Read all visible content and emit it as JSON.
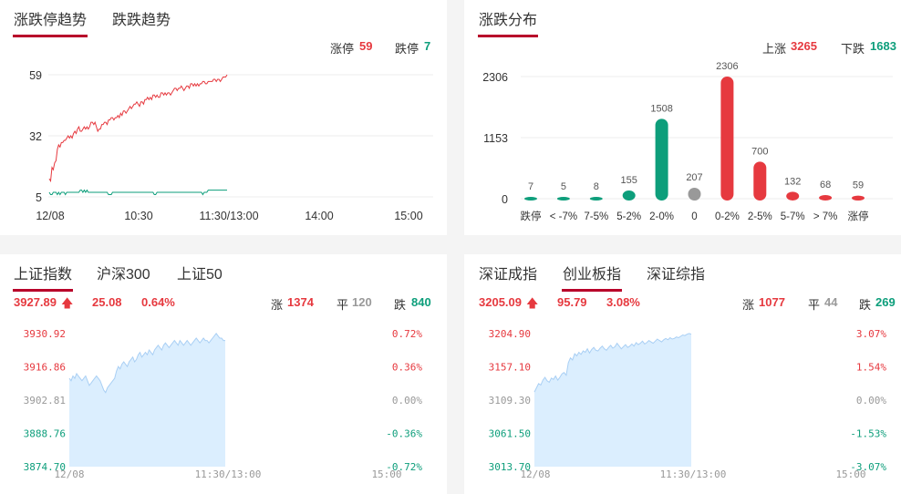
{
  "colors": {
    "up": "#e6393f",
    "down": "#0d9e7b",
    "flat": "#999999",
    "accent": "#b8002a",
    "area": "#dbeefe",
    "area_line": "#a9cff4"
  },
  "limit_panel": {
    "tabs": [
      "涨跌停趋势",
      "跌跌趋势"
    ],
    "up_label": "涨停",
    "up_value": "59",
    "down_label": "跌停",
    "down_value": "7"
  },
  "dist_panel": {
    "title": "涨跌分布",
    "up_label": "上涨",
    "up_value": "3265",
    "down_label": "下跌",
    "down_value": "1683"
  },
  "sh_panel": {
    "tabs": [
      "上证指数",
      "沪深300",
      "上证50"
    ],
    "price": "3927.89",
    "change": "25.08",
    "pct": "0.64%",
    "up_label": "涨",
    "up_value": "1374",
    "flat_label": "平",
    "flat_value": "120",
    "down_label": "跌",
    "down_value": "840"
  },
  "cyb_panel": {
    "tabs": [
      "深证成指",
      "创业板指",
      "深证综指"
    ],
    "price": "3205.09",
    "change": "95.79",
    "pct": "3.08%",
    "up_label": "涨",
    "up_value": "1077",
    "flat_label": "平",
    "flat_value": "44",
    "down_label": "跌",
    "down_value": "269"
  },
  "chart_data": [
    {
      "type": "line",
      "chart": "limit-trend",
      "y_ticks": [
        "59",
        "32",
        "5"
      ],
      "ylim": [
        5,
        59
      ],
      "x_ticks": [
        "12/08",
        "10:30",
        "11:30/13:00",
        "14:00",
        "15:00"
      ],
      "series": [
        {
          "color": "#e6393f",
          "values": [
            13,
            12,
            18,
            17,
            20,
            21,
            26,
            28,
            27,
            29,
            29,
            30,
            30,
            31,
            32,
            31,
            32,
            31,
            33,
            34,
            33,
            35,
            36,
            34,
            34,
            35,
            36,
            35,
            36,
            35,
            36,
            38,
            38,
            37,
            38,
            36,
            34,
            35,
            35,
            37,
            37,
            38,
            38,
            37,
            39,
            39,
            40,
            40,
            39,
            40,
            40,
            41,
            40,
            42,
            41,
            43,
            43,
            42,
            43,
            44,
            45,
            44,
            45,
            46,
            46,
            47,
            46,
            45,
            47,
            47,
            46,
            48,
            48,
            49,
            48,
            49,
            48,
            50,
            50,
            49,
            50,
            49,
            49,
            51,
            51,
            50,
            51,
            50,
            51,
            51,
            50,
            51,
            52,
            53,
            53,
            52,
            53,
            53,
            54,
            53,
            52,
            53,
            54,
            54,
            53,
            55,
            55,
            54,
            55,
            54,
            55,
            54,
            55,
            55,
            56,
            56,
            55,
            55,
            56,
            56,
            56,
            56,
            57,
            57,
            56,
            57,
            57,
            56,
            57,
            58,
            58,
            58,
            59
          ]
        },
        {
          "color": "#0d9e7b",
          "values": [
            7,
            6,
            6,
            7,
            7,
            7,
            6,
            7,
            6,
            7,
            7,
            7,
            6,
            7,
            7,
            7,
            7,
            7,
            7,
            7,
            7,
            7,
            7,
            8,
            8,
            7,
            8,
            7,
            8,
            7,
            7,
            7,
            7,
            7,
            7,
            7,
            7,
            7,
            7,
            7,
            7,
            7,
            7,
            7,
            6,
            6,
            6,
            7,
            7,
            7,
            7,
            7,
            7,
            7,
            7,
            7,
            7,
            7,
            7,
            7,
            7,
            7,
            7,
            7,
            7,
            7,
            7,
            7,
            7,
            7,
            7,
            7,
            7,
            7,
            7,
            7,
            7,
            7,
            6,
            6,
            7,
            7,
            7,
            7,
            7,
            7,
            7,
            7,
            7,
            7,
            7,
            7,
            7,
            7,
            7,
            7,
            7,
            7,
            7,
            7,
            7,
            7,
            7,
            7,
            7,
            7,
            7,
            7,
            7,
            7,
            7,
            7,
            7,
            7,
            6,
            7,
            7,
            7,
            8,
            8,
            8,
            8,
            8,
            8,
            8,
            8,
            8,
            8,
            8,
            8,
            8,
            8,
            8
          ]
        }
      ]
    },
    {
      "type": "bar",
      "chart": "distribution",
      "categories": [
        "跌停",
        "< -7%",
        "7-5%",
        "5-2%",
        "2-0%",
        "0",
        "0-2%",
        "2-5%",
        "5-7%",
        "> 7%",
        "涨停"
      ],
      "values": [
        7,
        5,
        8,
        155,
        1508,
        207,
        2306,
        700,
        132,
        68,
        59
      ],
      "colors": [
        "#0d9e7b",
        "#0d9e7b",
        "#0d9e7b",
        "#0d9e7b",
        "#0d9e7b",
        "#999999",
        "#e6393f",
        "#e6393f",
        "#e6393f",
        "#e6393f",
        "#e6393f"
      ],
      "y_ticks": [
        "2306",
        "1153",
        "0"
      ],
      "ylim": [
        0,
        2306
      ]
    },
    {
      "type": "area",
      "chart": "sh-index",
      "y_ticks_left": [
        "3930.92",
        "3916.86",
        "3902.81",
        "3888.76",
        "3874.70"
      ],
      "y_ticks_right": [
        "0.72%",
        "0.36%",
        "0.00%",
        "-0.36%",
        "-0.72%"
      ],
      "ylim": [
        3874.7,
        3930.92
      ],
      "x_ticks": [
        "12/08",
        "11:30/13:00",
        "15:00"
      ],
      "values": [
        3912,
        3911,
        3913,
        3912,
        3914,
        3913,
        3912,
        3911,
        3912,
        3913,
        3911,
        3909,
        3910,
        3911,
        3912,
        3913,
        3912,
        3911,
        3909,
        3907,
        3906,
        3908,
        3909,
        3910,
        3911,
        3912,
        3915,
        3917,
        3916,
        3918,
        3919,
        3918,
        3917,
        3919,
        3920,
        3921,
        3919,
        3920,
        3922,
        3923,
        3921,
        3922,
        3923,
        3922,
        3924,
        3923,
        3922,
        3924,
        3925,
        3926,
        3925,
        3924,
        3926,
        3927,
        3926,
        3925,
        3926,
        3927,
        3928,
        3927,
        3926,
        3928,
        3927,
        3926,
        3927,
        3928,
        3927,
        3926,
        3927,
        3928,
        3929,
        3928,
        3927,
        3928,
        3929,
        3928,
        3928,
        3927,
        3928,
        3929,
        3930,
        3931,
        3930,
        3929,
        3929,
        3928,
        3928
      ]
    },
    {
      "type": "area",
      "chart": "cyb-index",
      "y_ticks_left": [
        "3204.90",
        "3157.10",
        "3109.30",
        "3061.50",
        "3013.70"
      ],
      "y_ticks_right": [
        "3.07%",
        "1.54%",
        "0.00%",
        "-1.53%",
        "-3.07%"
      ],
      "ylim": [
        3013.7,
        3204.9
      ],
      "x_ticks": [
        "12/08",
        "11:30/13:00",
        "15:00"
      ],
      "values": [
        3121,
        3127,
        3133,
        3131,
        3138,
        3142,
        3137,
        3135,
        3141,
        3139,
        3144,
        3138,
        3142,
        3147,
        3149,
        3145,
        3163,
        3170,
        3167,
        3176,
        3173,
        3178,
        3175,
        3180,
        3178,
        3183,
        3177,
        3182,
        3185,
        3181,
        3180,
        3184,
        3187,
        3183,
        3181,
        3185,
        3188,
        3184,
        3186,
        3191,
        3187,
        3183,
        3186,
        3189,
        3185,
        3187,
        3190,
        3187,
        3192,
        3189,
        3191,
        3194,
        3190,
        3192,
        3195,
        3193,
        3191,
        3194,
        3197,
        3195,
        3193,
        3196,
        3198,
        3196,
        3199,
        3197,
        3198,
        3200,
        3199,
        3201,
        3203,
        3202,
        3204,
        3205,
        3204
      ]
    }
  ]
}
